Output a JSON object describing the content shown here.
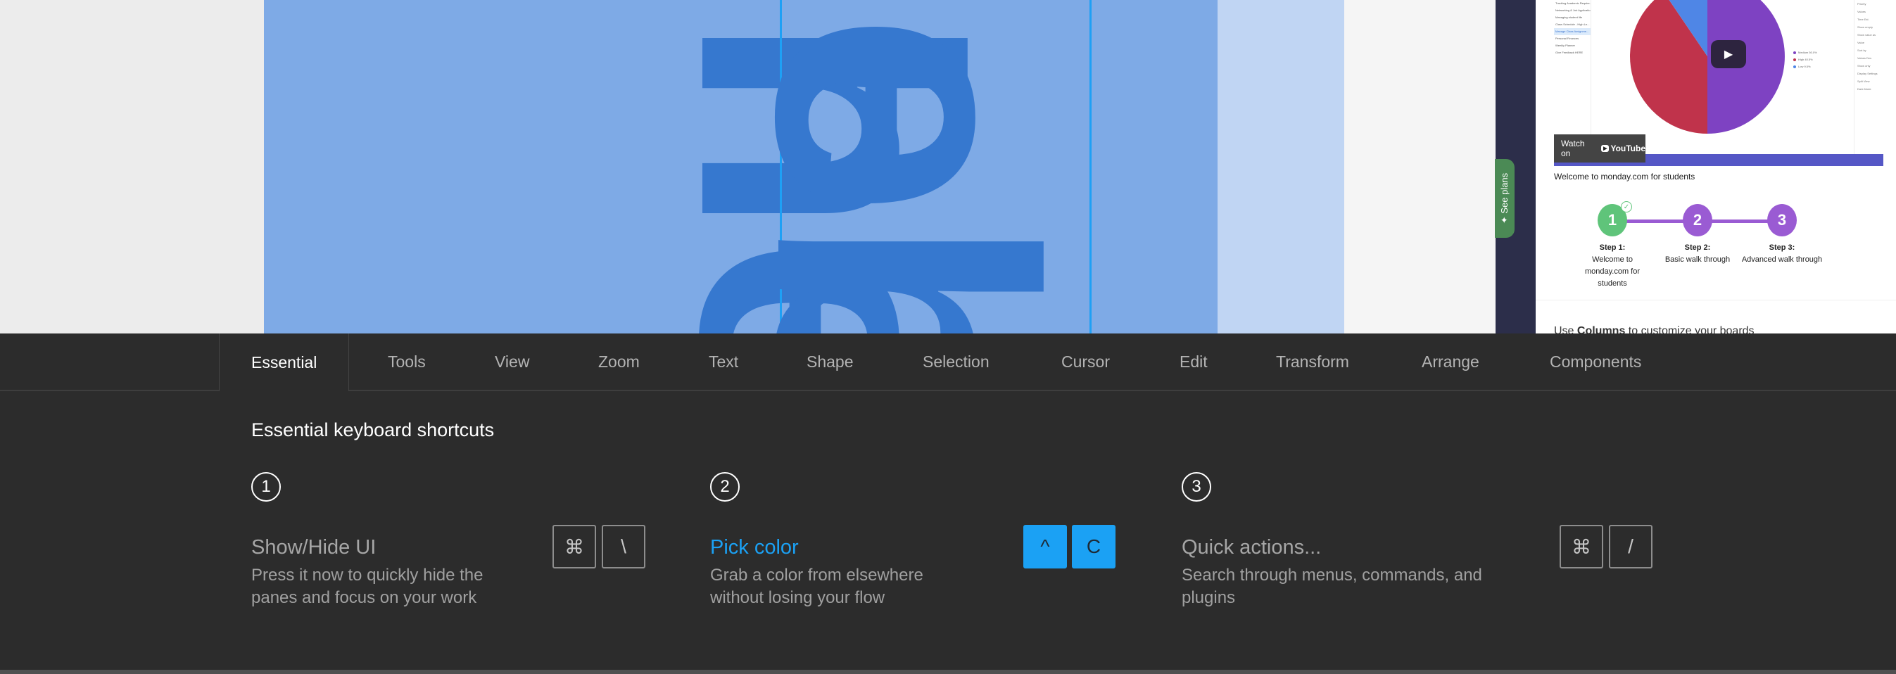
{
  "canvas": {
    "big_text_1": "nhe",
    "big_text_2": "neb",
    "colors": {
      "frame": "#7eaae6",
      "frame_light": "#c0d5f3",
      "text": "#3678cf",
      "selection": "#1ea0f5"
    }
  },
  "embed": {
    "see_plans_label": "See plans",
    "sidebar_items": [
      "Tracking Academic Require...",
      "Networking & Job Applicatio...",
      "Managing student life",
      "Class Schedule - High Le...",
      "Manage Class Assignme...",
      "Personal Finances",
      "Weekly Planner",
      "Give Feedback HERE"
    ],
    "active_sidebar_index": 4,
    "pie_chart": {
      "slices": [
        {
          "label": "Medium",
          "value": 50.0,
          "color": "#7e42c2"
        },
        {
          "label": "High",
          "value": 40.5,
          "color": "#c0334b"
        },
        {
          "label": "Low",
          "value": 9.5,
          "color": "#4f86e6"
        }
      ],
      "legend": [
        "Medium 50.0%",
        "High 40.5%",
        "Low 9.5%"
      ]
    },
    "settings_items": [
      "Priority",
      "Values",
      "Time Est.",
      "Show empty",
      "Show value as",
      "Value",
      "Sort by",
      "Values Des",
      "Show only",
      "Display Settings",
      "Split View",
      "Dark Mode"
    ],
    "watch_on": "Watch on",
    "youtube": "YouTube",
    "caption": "Welcome to monday.com for students",
    "steps": [
      {
        "number": "1",
        "title": "Step 1:",
        "desc": "Welcome to monday.com for students",
        "color": "#5fc47a",
        "done": true
      },
      {
        "number": "2",
        "title": "Step 2:",
        "desc": "Basic walk through",
        "color": "#9a5bd3",
        "done": false
      },
      {
        "number": "3",
        "title": "Step 3:",
        "desc": "Advanced walk through",
        "color": "#9a5bd3",
        "done": false
      }
    ],
    "next_section_prefix": "Use ",
    "next_section_bold": "Columns",
    "next_section_suffix": " to customize your boards"
  },
  "tabs": [
    {
      "label": "Essential",
      "active": true
    },
    {
      "label": "Tools"
    },
    {
      "label": "View"
    },
    {
      "label": "Zoom"
    },
    {
      "label": "Text"
    },
    {
      "label": "Shape"
    },
    {
      "label": "Selection"
    },
    {
      "label": "Cursor"
    },
    {
      "label": "Edit"
    },
    {
      "label": "Transform"
    },
    {
      "label": "Arrange"
    },
    {
      "label": "Components"
    }
  ],
  "panel": {
    "heading": "Essential keyboard shortcuts",
    "shortcuts": [
      {
        "number": "1",
        "title": "Show/Hide UI",
        "desc": "Press it now to quickly hide the panes and focus on your work",
        "keys": [
          "⌘",
          "\\"
        ],
        "highlighted": false
      },
      {
        "number": "2",
        "title": "Pick color",
        "desc": "Grab a color from elsewhere without losing your flow",
        "keys": [
          "^",
          "C"
        ],
        "highlighted": true
      },
      {
        "number": "3",
        "title": "Quick actions...",
        "desc": "Search through menus, commands, and plugins",
        "keys": [
          "⌘",
          "/"
        ],
        "highlighted": false
      }
    ],
    "accent_color": "#1ba1f4"
  }
}
